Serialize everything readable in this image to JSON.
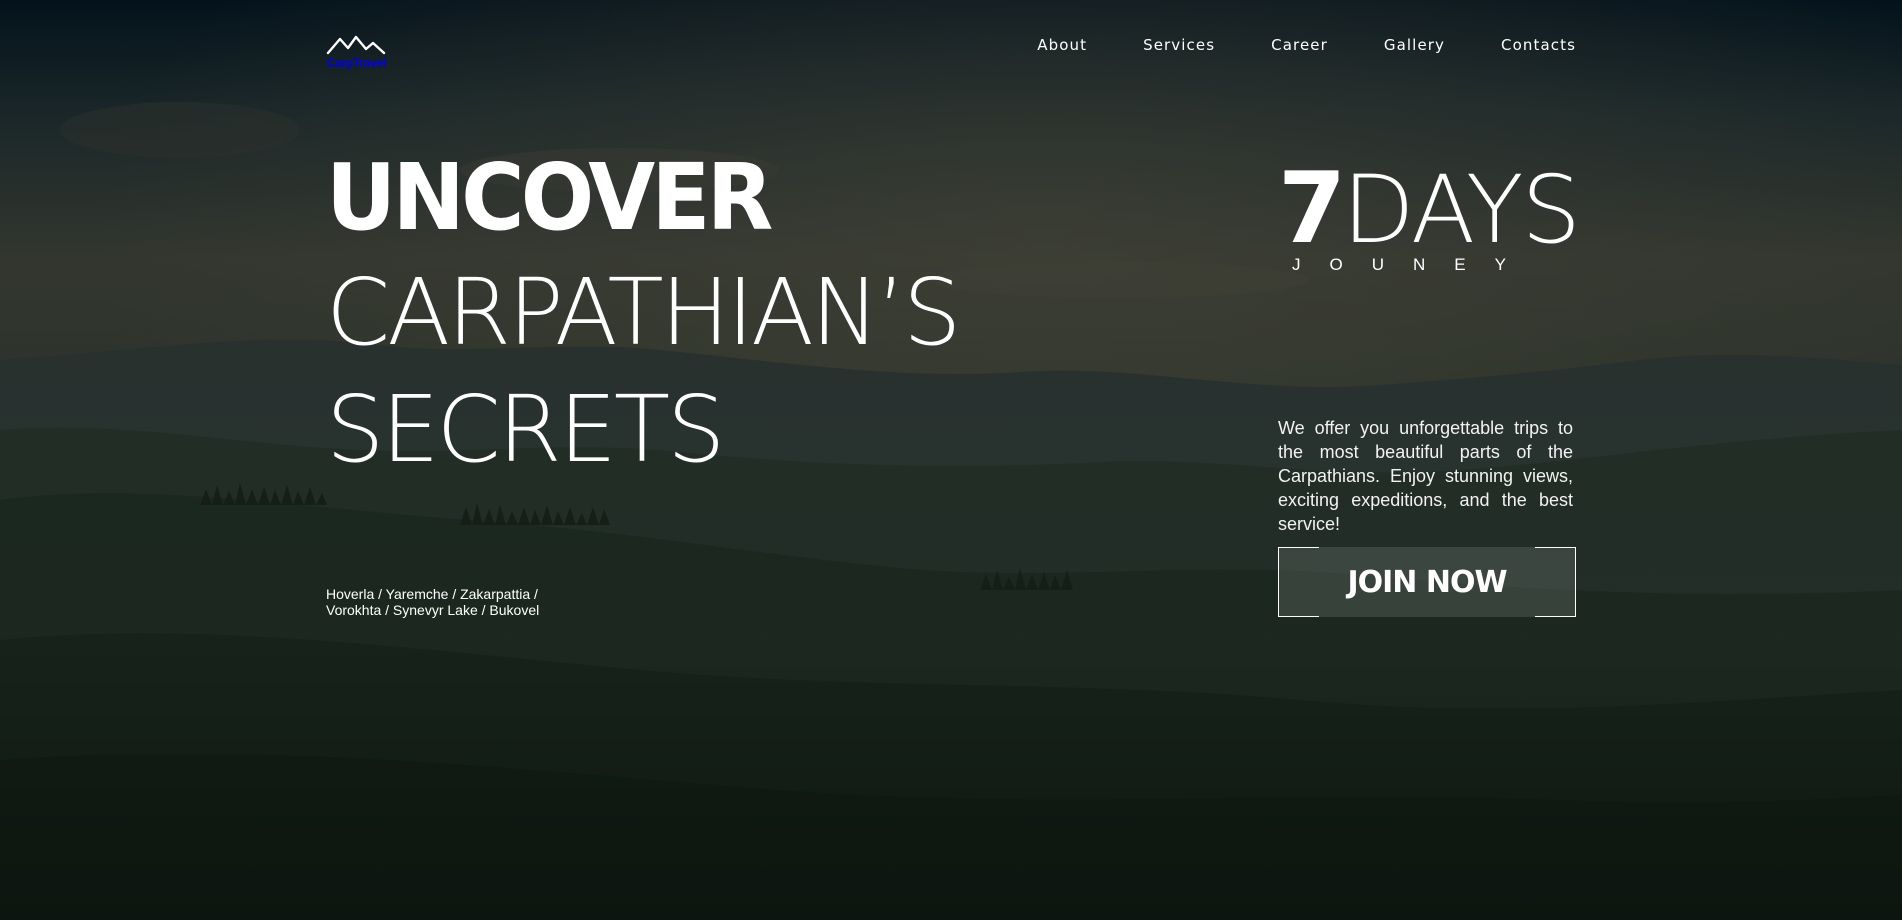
{
  "brand": {
    "logo_text": "CarpTravel"
  },
  "nav": {
    "items": [
      "About",
      "Services",
      "Career",
      "Gallery",
      "Contacts"
    ]
  },
  "hero": {
    "title_line1": "UNCOVER",
    "title_line2": "CARPATHIAN’S",
    "title_line3": "SECRETS",
    "places_line1": "Hoverla / Yaremche / Zakarpattia /",
    "places_line2": "Vorokhta / Synevyr Lake / Bukovel",
    "days_number": "7",
    "days_word": "DAYS",
    "journey": "JOUNEY",
    "description": "We offer you unforgettable trips to the most beautiful parts of the Carpathians. Enjoy stunning views, exciting expeditions, and the best service!",
    "cta_label": "JOIN NOW"
  },
  "colors": {
    "overlay": "#0f1a17",
    "text": "#ffffff",
    "button_bg": "rgba(255,255,255,0.12)"
  },
  "icons": {
    "logo": "mountain-logo-icon"
  }
}
